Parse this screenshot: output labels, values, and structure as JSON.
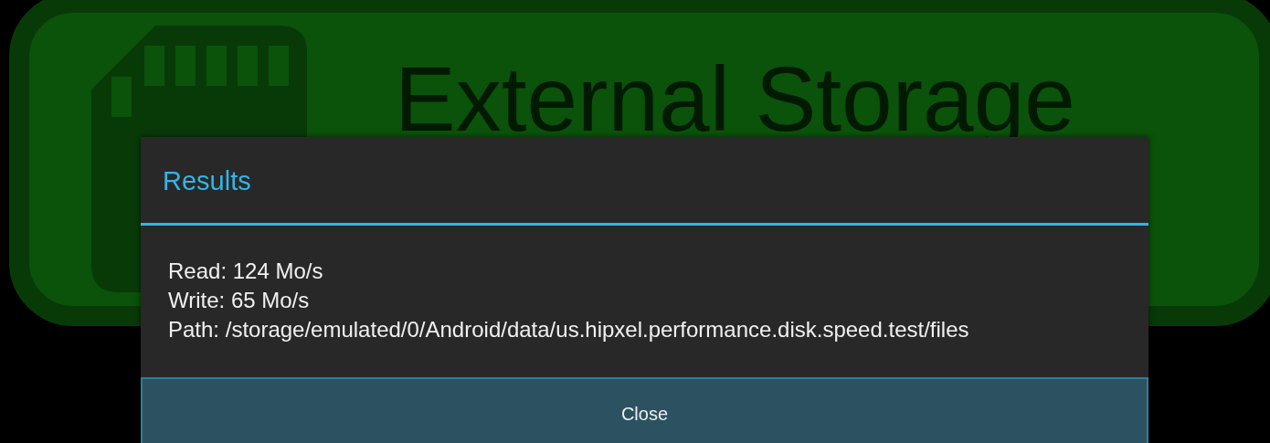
{
  "background_button": {
    "label": "External Storage"
  },
  "dialog": {
    "title": "Results",
    "lines": [
      "Read: 124 Mo/s",
      "Write: 65 Mo/s",
      "Path: /storage/emulated/0/Android/data/us.hipxel.performance.disk.speed.test/files"
    ],
    "buttons": [
      "Close"
    ]
  }
}
